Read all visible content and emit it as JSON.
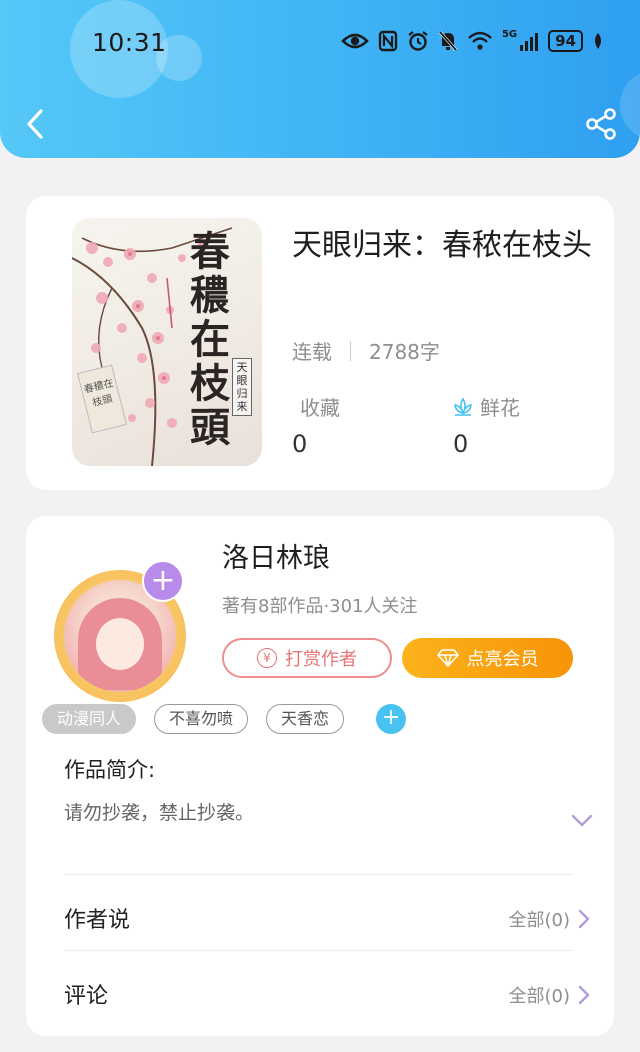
{
  "status_bar": {
    "time": "10:31",
    "battery": "94",
    "network_label": "5G",
    "icons": [
      "eye-icon",
      "nfc-icon",
      "alarm-icon",
      "mute-icon",
      "wifi-icon",
      "signal-icon",
      "battery-icon",
      "leaf-icon"
    ]
  },
  "header": {
    "back_icon": "chevron-left-icon",
    "share_icon": "share-icon",
    "gradient_colors": [
      "#55c8f7",
      "#2f9ff0"
    ]
  },
  "book": {
    "cover_calligraphy": "春穠在枝頭",
    "cover_tag": "天眼归来",
    "cover_hanging": "春穠在枝頭",
    "title": "天眼归来：春秾在枝头",
    "status": "连载",
    "word_count": "2788字",
    "favorites_label": "收藏",
    "favorites_count": "0",
    "flowers_label": "鲜花",
    "flowers_count": "0",
    "flower_icon": "lotus-icon"
  },
  "author": {
    "name": "洛日林琅",
    "meta": "著有8部作品·301人关注",
    "follow_icon": "plus-icon",
    "reward_label": "打赏作者",
    "reward_icon": "yen-icon",
    "vip_label": "点亮会员",
    "vip_icon": "diamond-icon"
  },
  "tags": [
    "动漫同人",
    "不喜勿喷",
    "天香恋"
  ],
  "intro": {
    "title": "作品简介:",
    "text": "请勿抄袭，禁止抄袭。"
  },
  "sections": [
    {
      "label": "作者说",
      "right": "全部(0)"
    },
    {
      "label": "评论",
      "right": "全部(0)"
    }
  ],
  "colors": {
    "accent_blue": "#48c3f1",
    "reward_red": "#e57474",
    "vip_orange": "#f89307",
    "chevron_purple": "#b39ddb"
  }
}
